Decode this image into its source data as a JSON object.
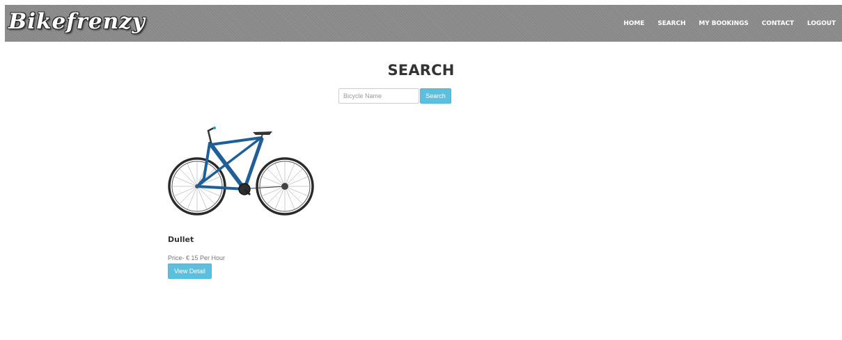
{
  "header": {
    "brand": "Bikefrenzy",
    "nav": [
      {
        "label": "HOME"
      },
      {
        "label": "SEARCH"
      },
      {
        "label": "MY BOOKINGS"
      },
      {
        "label": "CONTACT"
      },
      {
        "label": "LOGOUT"
      }
    ]
  },
  "main": {
    "title": "SEARCH",
    "search": {
      "placeholder": "Bicycle Name",
      "value": "",
      "button_label": "Search"
    },
    "results": [
      {
        "name": "Dullet",
        "price": "Price- € 15 Per Hour",
        "button_label": "View Detail",
        "image_icon": "bicycle-image"
      }
    ]
  },
  "colors": {
    "navbar": "#8c8c8c",
    "accent": "#5bc0de",
    "bike_frame": "#1f5f98"
  }
}
